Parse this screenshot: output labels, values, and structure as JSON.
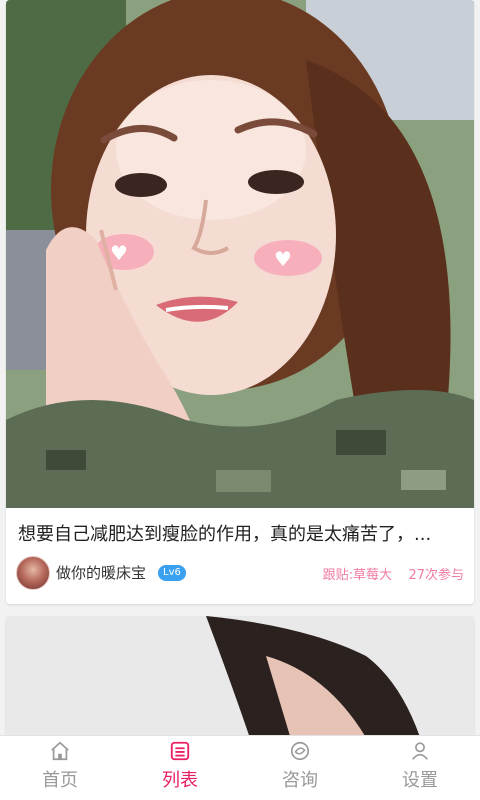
{
  "feed": {
    "posts": [
      {
        "title": "想要自己减肥达到瘦脸的作用，真的是太痛苦了，...",
        "author": {
          "name": "做你的暖床宝",
          "level": "Lv6"
        },
        "follow_label": "跟贴:草莓大",
        "participants": "27次参与"
      }
    ]
  },
  "tabbar": {
    "active_index": 1,
    "items": [
      {
        "label": "首页",
        "icon": "home-icon"
      },
      {
        "label": "列表",
        "icon": "list-icon"
      },
      {
        "label": "咨询",
        "icon": "consult-icon"
      },
      {
        "label": "设置",
        "icon": "profile-icon"
      }
    ]
  },
  "colors": {
    "accent": "#e91e63",
    "pink_text": "#f07aa3",
    "badge": "#3aa0f0",
    "inactive": "#999999"
  }
}
